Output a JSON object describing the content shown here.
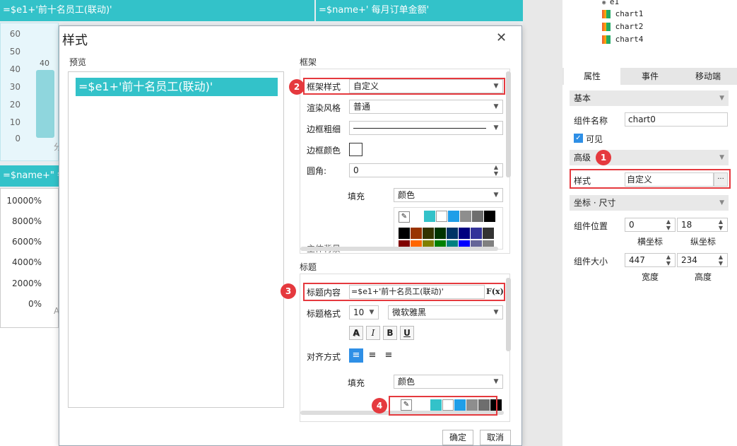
{
  "background": {
    "top_bar_1": "=$e1+'前十名员工(联动)'",
    "top_bar_2": "=$name+' 每月订单金额'",
    "mid_bar": "=$name+\" 每",
    "chart_top_axis": [
      "60",
      "50",
      "40",
      "30",
      "20",
      "10",
      "0"
    ],
    "chart_top_bar_label": "40",
    "chart_top_x_label": "分",
    "chart_bottom_axis": [
      "10000%",
      "8000%",
      "6000%",
      "4000%",
      "2000%",
      "0%"
    ],
    "chart_bottom_x_label": "A"
  },
  "dialog": {
    "title": "样式",
    "close_glyph": "✕",
    "preview_label": "预览",
    "preview_title": "=$e1+'前十名员工(联动)'",
    "frame_section": "框架",
    "frame_style_label": "框架样式",
    "frame_style_value": "自定义",
    "render_style_label": "渲染风格",
    "render_style_value": "普通",
    "border_width_label": "边框粗细",
    "border_color_label": "边框颜色",
    "corner_label": "圆角:",
    "corner_value": "0",
    "fill_label": "填充",
    "fill_value": "颜色",
    "overall_bg_label": "主体背景",
    "title_section": "标题",
    "title_content_label": "标题内容",
    "title_content_value": "=$e1+'前十名员工(联动)'",
    "formula_button": "F(x)",
    "title_format_label": "标题格式",
    "font_size": "10",
    "font_family": "微软雅黑",
    "format_buttons": [
      "A",
      "I",
      "B",
      "U"
    ],
    "align_label": "对齐方式",
    "title_fill_label": "填充",
    "title_fill_value": "颜色",
    "ok_button": "确定",
    "cancel_button": "取消",
    "badges": [
      "1",
      "2",
      "3",
      "4"
    ]
  },
  "palette_top_row": [
    "#33c2c9",
    "#ffffff",
    "#1f9ee8",
    "#8e8e8e",
    "#6e6e6e",
    "#000000"
  ],
  "palette_grid": [
    [
      "#000000",
      "#993300",
      "#333300",
      "#003300",
      "#003366",
      "#000080",
      "#333399",
      "#333333"
    ],
    [
      "#800000",
      "#ff6600",
      "#808000",
      "#008000",
      "#008080",
      "#0000ff",
      "#666699",
      "#808080"
    ]
  ],
  "title_palette": [
    "#33c2c9",
    "#ffffff",
    "#1f9ee8",
    "#8e8e8e",
    "#6e6e6e",
    "#000000"
  ],
  "right_panel": {
    "tree_items": [
      "e1",
      "chart1",
      "chart2",
      "chart4"
    ],
    "tabs": [
      "属性",
      "事件",
      "移动端"
    ],
    "basic_section": "基本",
    "component_name_label": "组件名称",
    "component_name_value": "chart0",
    "visible_label": "可见",
    "advanced_section": "高级",
    "style_label": "样式",
    "style_value": "自定义",
    "ellipsis": "···",
    "coord_section": "坐标 · 尺寸",
    "position_label": "组件位置",
    "pos_x": "0",
    "pos_y": "18",
    "x_label": "横坐标",
    "y_label": "纵坐标",
    "size_label": "组件大小",
    "width": "447",
    "height": "234",
    "width_label": "宽度",
    "height_label": "高度"
  }
}
